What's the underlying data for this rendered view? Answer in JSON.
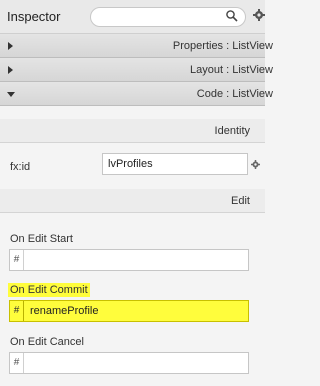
{
  "window": {
    "title": "Inspector"
  },
  "search": {
    "placeholder": ""
  },
  "sections": [
    {
      "label": "Properties : ListView",
      "expanded": false
    },
    {
      "label": "Layout : ListView",
      "expanded": false
    },
    {
      "label": "Code : ListView",
      "expanded": true
    }
  ],
  "identity": {
    "heading": "Identity",
    "fxid_label": "fx:id",
    "fxid_value": "lvProfiles"
  },
  "edit": {
    "heading": "Edit",
    "on_edit_start": {
      "label": "On Edit Start",
      "prefix": "#",
      "value": ""
    },
    "on_edit_commit": {
      "label": "On Edit Commit",
      "prefix": "#",
      "value": "renameProfile",
      "highlighted": true
    },
    "on_edit_cancel": {
      "label": "On Edit Cancel",
      "prefix": "#",
      "value": ""
    }
  },
  "colors": {
    "highlight": "#fffd3c",
    "section_bg": "#d9d9d9"
  },
  "icons": [
    "search-icon",
    "gear-icon",
    "expand-arrow-icon",
    "collapse-arrow-icon"
  ]
}
